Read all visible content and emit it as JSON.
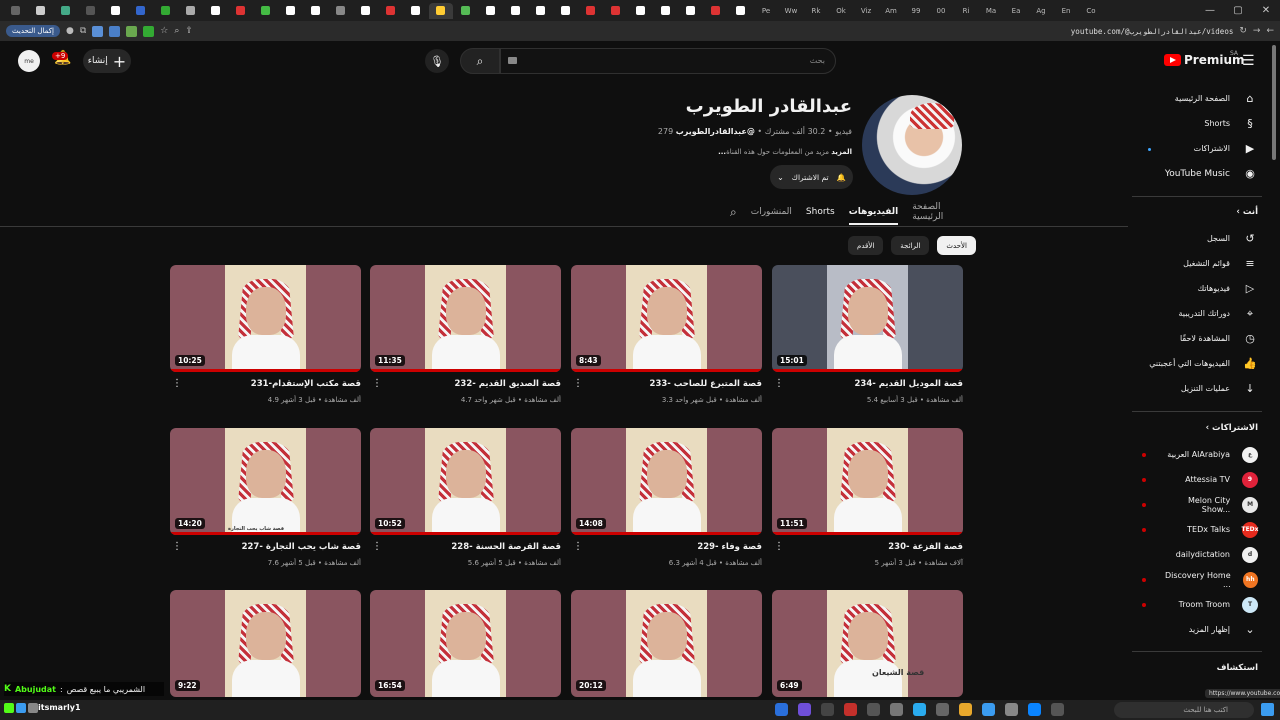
{
  "browser": {
    "tabs": [
      {
        "label": "",
        "color": "#666"
      },
      {
        "label": "",
        "color": "#ccc"
      },
      {
        "label": "",
        "color": "#4a8"
      },
      {
        "label": "",
        "color": "#555"
      },
      {
        "label": "",
        "color": "#fff"
      },
      {
        "label": "",
        "color": "#36c"
      },
      {
        "label": "",
        "color": "#3a3"
      },
      {
        "label": "",
        "color": "#aaa"
      },
      {
        "label": "",
        "color": "#fff"
      },
      {
        "label": "",
        "color": "#d33"
      },
      {
        "label": "",
        "color": "#4b4"
      },
      {
        "label": "",
        "color": "#fff"
      },
      {
        "label": "",
        "color": "#fff"
      },
      {
        "label": "",
        "color": "#888"
      },
      {
        "label": "",
        "color": "#fff"
      },
      {
        "label": "",
        "color": "#d33"
      },
      {
        "label": "",
        "color": "#fff"
      },
      {
        "label": "",
        "color": "#fc3"
      },
      {
        "label": "",
        "color": "#5b5"
      },
      {
        "label": "",
        "color": "#fff"
      },
      {
        "label": "",
        "color": "#fff"
      },
      {
        "label": "",
        "color": "#fff"
      },
      {
        "label": "",
        "color": "#fff"
      },
      {
        "label": "",
        "color": "#d33"
      },
      {
        "label": "",
        "color": "#d33"
      },
      {
        "label": "",
        "color": "#fff"
      },
      {
        "label": "",
        "color": "#fff"
      },
      {
        "label": "",
        "color": "#fff"
      },
      {
        "label": "",
        "color": "#d33"
      },
      {
        "label": "",
        "color": "#fff"
      }
    ],
    "tab_labels_visible": [
      "Pe",
      "Ww",
      "Rk",
      "Ok",
      "Viz",
      "Am",
      "99",
      "00",
      "Ri",
      "Ma",
      "Ea",
      "Ag",
      "En",
      "Co"
    ],
    "update_button": "إكمال التحديث",
    "url": "youtube.com/@عبدالقادرالطويرب/videos",
    "status_url": "https://www.youtube.com/"
  },
  "topbar": {
    "create_label": "إنشاء",
    "notif_count": "+9",
    "search_placeholder": "بحث",
    "logo_text": "Premium",
    "logo_sup": "SA",
    "me_avatar": "me"
  },
  "channel": {
    "name": "عبدالقادر الطويرب",
    "handle": "@عبدالقادرالطويرب",
    "subscribers": "30.2 ألف مشترك",
    "video_count": "279 فيديو",
    "description": "مزيد من المعلومات حول هذه القناة",
    "more": "...المزيد",
    "subscribed_label": "تم الاشتراك",
    "tabs": [
      "الصفحة الرئيسية",
      "الفيديوهات",
      "Shorts",
      "المنشورات"
    ],
    "active_tab": "الفيديوهات"
  },
  "chips": [
    "الأحدث",
    "الرائجة",
    "الأقدم"
  ],
  "videos": [
    {
      "title": "234- قصة الموديل القديم",
      "meta": "5.4 ألف مشاهدة • قبل 3 أسابيع",
      "duration": "15:01",
      "bg": "#4a4f5c",
      "frame": "#b8bcc6"
    },
    {
      "title": "233- قصة المتبرع للصاحب",
      "meta": "3.3 ألف مشاهدة • قبل شهر واحد",
      "duration": "8:43",
      "bg": "#8a5560",
      "frame": "#e9dcc0"
    },
    {
      "title": "232- قصة الصديق القديم",
      "meta": "4.7 ألف مشاهدة • قبل شهر واحد",
      "duration": "11:35",
      "bg": "#8a5560",
      "frame": "#e9dcc0"
    },
    {
      "title": "231-قصة مكتب الإستقدام",
      "meta": "4.9 ألف مشاهدة • قبل 3 أشهر",
      "duration": "10:25",
      "bg": "#8a5560",
      "frame": "#e9dcc0"
    },
    {
      "title": "230- قصة الفزعة",
      "meta": "5 آلاف مشاهدة • قبل 3 أشهر",
      "duration": "11:51",
      "bg": "#8a5560",
      "frame": "#e9dcc0"
    },
    {
      "title": "229- قصة وفاء",
      "meta": "6.3 ألف مشاهدة • قبل 4 أشهر",
      "duration": "14:08",
      "bg": "#8a5560",
      "frame": "#e9dcc0"
    },
    {
      "title": "228- قصة القرصة الحسنة",
      "meta": "5.6 ألف مشاهدة • قبل 5 أشهر",
      "duration": "10:52",
      "bg": "#8a5560",
      "frame": "#e9dcc0"
    },
    {
      "title": "227- قصة شاب يحب التجارة",
      "meta": "7.6 ألف مشاهدة • قبل 5 أشهر",
      "duration": "14:20",
      "bg": "#8a5560",
      "frame": "#e9dcc0"
    },
    {
      "title": "",
      "meta": "",
      "duration": "6:49",
      "bg": "#8a5560",
      "frame": "#e9dcc0"
    },
    {
      "title": "",
      "meta": "",
      "duration": "20:12",
      "bg": "#8a5560",
      "frame": "#e9dcc0"
    },
    {
      "title": "",
      "meta": "",
      "duration": "16:54",
      "bg": "#8a5560",
      "frame": "#e9dcc0"
    },
    {
      "title": "",
      "meta": "",
      "duration": "9:22",
      "bg": "#8a5560",
      "frame": "#e9dcc0"
    }
  ],
  "thumb_captions": {
    "v7": "قصة شاب يحب التجارة",
    "v8": "قصة الشيعان"
  },
  "sidebar": {
    "main": [
      {
        "label": "الصفحة الرئيسية",
        "icon": "home-icon",
        "glyph": "⌂"
      },
      {
        "label": "Shorts",
        "icon": "shorts-icon",
        "glyph": "§"
      },
      {
        "label": "الاشتراكات",
        "icon": "subscriptions-icon",
        "glyph": "▶"
      },
      {
        "label": "YouTube Music",
        "icon": "music-icon",
        "glyph": "◉"
      }
    ],
    "you_header": "أنت",
    "you": [
      {
        "label": "السجل",
        "icon": "history-icon",
        "glyph": "↺"
      },
      {
        "label": "قوائم التشغيل",
        "icon": "playlists-icon",
        "glyph": "≡"
      },
      {
        "label": "فيديوهاتك",
        "icon": "your-videos-icon",
        "glyph": "▷"
      },
      {
        "label": "دوراتك التدريبية",
        "icon": "courses-icon",
        "glyph": "⌖"
      },
      {
        "label": "المشاهدة لاحقًا",
        "icon": "watch-later-icon",
        "glyph": "◷"
      },
      {
        "label": "الفيديوهات التي أعجبتني",
        "icon": "liked-icon",
        "glyph": "👍"
      },
      {
        "label": "عمليات التنزيل",
        "icon": "download-icon",
        "glyph": "↓"
      }
    ],
    "subs_header": "الاشتراكات",
    "subs": [
      {
        "label": "العربية AlArabiya",
        "color": "#f1f1f1",
        "text": "ع",
        "text_color": "#333",
        "live": true
      },
      {
        "label": "Attessia TV",
        "color": "#e0223a",
        "text": "9",
        "text_color": "#fff",
        "live": true
      },
      {
        "label": "Melon City Show...",
        "color": "#e8e8e8",
        "text": "M",
        "text_color": "#333",
        "live": true
      },
      {
        "label": "TEDx Talks",
        "color": "#e62b1e",
        "text": "TEDx",
        "text_color": "#fff",
        "live": true
      },
      {
        "label": "dailydictation",
        "color": "#f1f1f1",
        "text": "d",
        "text_color": "#333",
        "live": false
      },
      {
        "label": "Discovery Home ...",
        "color": "#f07522",
        "text": "hh",
        "text_color": "#fff",
        "live": true
      },
      {
        "label": "Troom Troom",
        "color": "#cde8f7",
        "text": "T",
        "text_color": "#333",
        "live": true
      }
    ],
    "show_more": "إظهار المزيد",
    "explore_header": "استكشاف"
  },
  "taskbar": {
    "chat_user": "Abujudat",
    "chat_text": "الشمريبي ما يبيع قصص",
    "user": "itsmarly1",
    "search_placeholder": "اكتب هنا للبحث"
  }
}
